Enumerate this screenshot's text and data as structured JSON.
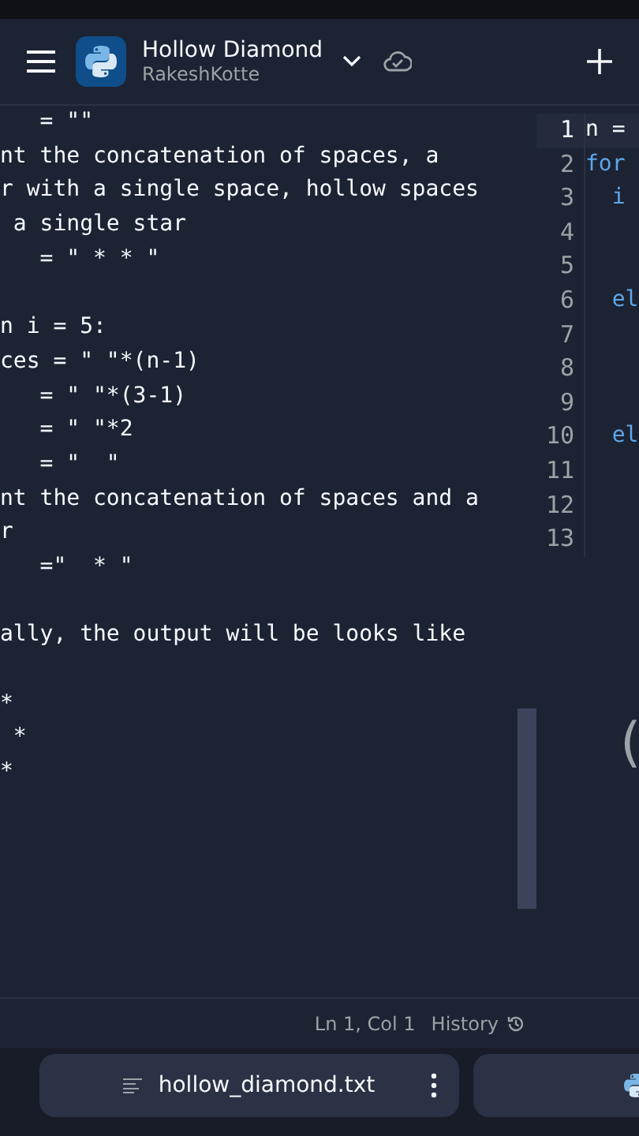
{
  "header": {
    "title": "Hollow Diamond",
    "owner": "RakeshKotte"
  },
  "left_pane": {
    "lines": [
      {
        "kind": "text",
        "text": "   = \"\""
      },
      {
        "kind": "text",
        "text": "nt the concatenation of spaces, a"
      },
      {
        "kind": "text",
        "text": "r with a single space, hollow spaces"
      },
      {
        "kind": "text",
        "text": " a single star"
      },
      {
        "kind": "text",
        "text": "   = \" * * \""
      },
      {
        "kind": "blank"
      },
      {
        "kind": "text",
        "text": "n i = 5:"
      },
      {
        "kind": "text",
        "text": "ces = \" \"*(n-1)"
      },
      {
        "kind": "text",
        "text": "   = \" \"*(3-1)"
      },
      {
        "kind": "text",
        "text": "   = \" \"*2"
      },
      {
        "kind": "text",
        "text": "   = \"  \""
      },
      {
        "kind": "text",
        "text": "nt the concatenation of spaces and a"
      },
      {
        "kind": "text",
        "text": "r"
      },
      {
        "kind": "text",
        "text": "   =\"  * \""
      },
      {
        "kind": "blank"
      },
      {
        "kind": "text",
        "text": "ally, the output will be looks like"
      },
      {
        "kind": "blank"
      },
      {
        "kind": "text",
        "text": "*"
      },
      {
        "kind": "text",
        "text": " *"
      },
      {
        "kind": "text",
        "text": "*"
      }
    ]
  },
  "editor": {
    "lines": [
      {
        "number": "1",
        "code": "n =",
        "active": true
      },
      {
        "number": "2",
        "code": "for",
        "active": false
      },
      {
        "number": "3",
        "code": "  i",
        "active": false
      },
      {
        "number": "4",
        "active": false
      },
      {
        "number": "5",
        "active": false
      },
      {
        "number": "6",
        "code": "  el",
        "active": false
      },
      {
        "number": "7",
        "active": false
      },
      {
        "number": "8",
        "active": false
      },
      {
        "number": "9",
        "active": false
      },
      {
        "number": "10",
        "code": "  el",
        "active": false
      },
      {
        "number": "11",
        "active": false
      },
      {
        "number": "12",
        "active": false
      },
      {
        "number": "13",
        "active": false
      }
    ],
    "fragment": "("
  },
  "status_bar": {
    "position": "Ln 1, Col 1",
    "history": "History"
  },
  "file_tabs": [
    {
      "kind": "text",
      "label": "hollow_diamond.txt"
    },
    {
      "kind": "python"
    }
  ]
}
